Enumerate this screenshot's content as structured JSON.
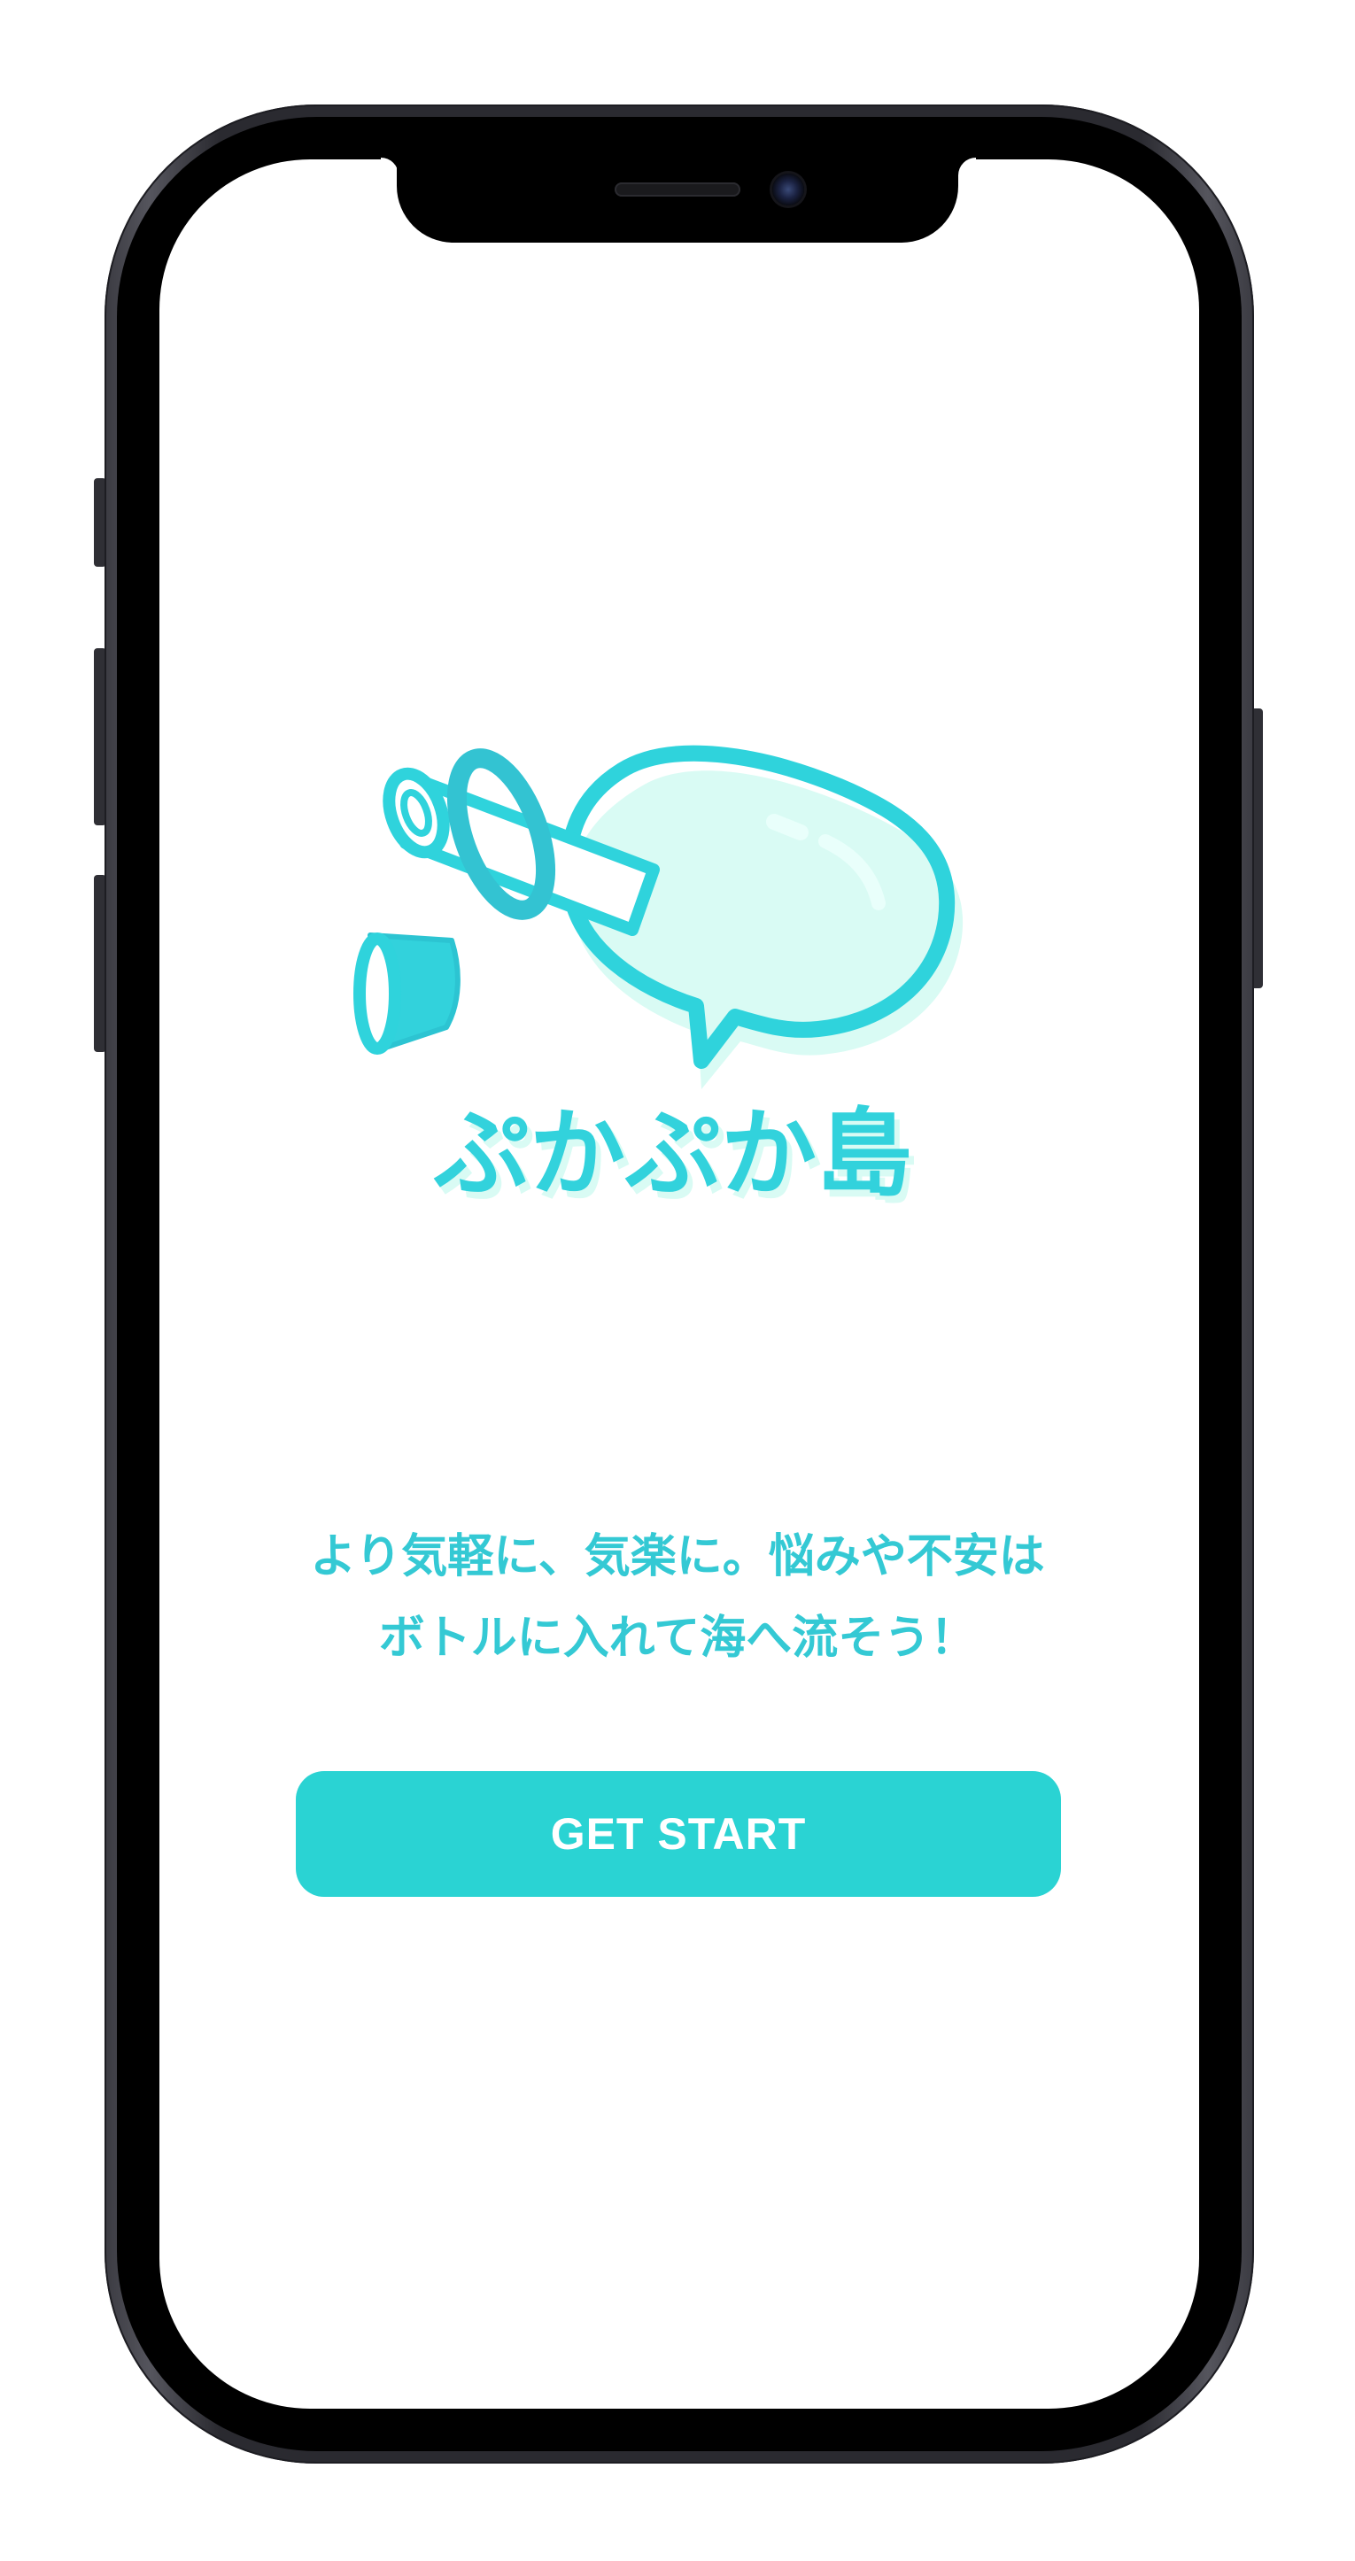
{
  "app": {
    "logo_text": "ぷかぷか島"
  },
  "main": {
    "tagline_line1": "より気軽に、気楽に。悩みや不安は",
    "tagline_line2": "ボトルに入れて海へ流そう！",
    "start_button_label": "GET START"
  },
  "colors": {
    "accent": "#2ad3d3",
    "text_accent": "#34c9d4",
    "logo_fill_light": "#d9fbf4",
    "background": "#ffffff"
  },
  "icons": {
    "logo": "message-in-bottle-icon",
    "cork": "bottle-cork-icon"
  }
}
